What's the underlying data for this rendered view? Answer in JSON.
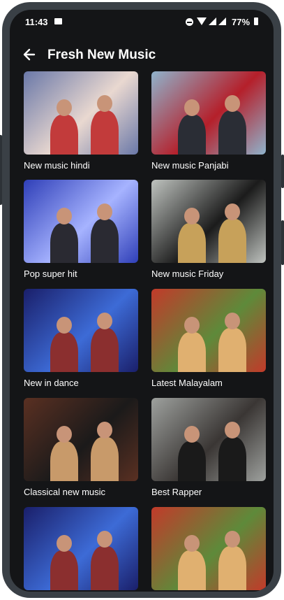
{
  "status_bar": {
    "time": "11:43",
    "battery": "77%"
  },
  "app_bar": {
    "back_icon": "arrow-left-icon",
    "title": "Fresh New Music"
  },
  "playlists": [
    {
      "label": "New music hindi",
      "colors": [
        "#6a78a8",
        "#e9d8d0",
        "#c23b3b"
      ]
    },
    {
      "label": "New music Panjabi",
      "colors": [
        "#8fb3cc",
        "#b51f2a",
        "#2a2d35"
      ]
    },
    {
      "label": "Pop super hit",
      "colors": [
        "#2f3fb8",
        "#a6b3ff",
        "#2a2a32"
      ]
    },
    {
      "label": "New music Friday",
      "colors": [
        "#bfc3bf",
        "#1b1b1b",
        "#c7a15a"
      ]
    },
    {
      "label": "New in dance",
      "colors": [
        "#1a1f6a",
        "#3d6bd6",
        "#8b2f2f"
      ]
    },
    {
      "label": "Latest Malayalam",
      "colors": [
        "#c23a2a",
        "#5e8a3a",
        "#e0b070"
      ]
    },
    {
      "label": "Classical new music",
      "colors": [
        "#5a3022",
        "#1b1a1a",
        "#c89a6a"
      ]
    },
    {
      "label": "Best Rapper",
      "colors": [
        "#9ea19e",
        "#3a3634",
        "#1a1a1a"
      ]
    },
    {
      "label": "",
      "colors": [
        "#1a1f6a",
        "#3d6bd6",
        "#8b2f2f"
      ]
    },
    {
      "label": "",
      "colors": [
        "#c23a2a",
        "#5e8a3a",
        "#e0b070"
      ]
    }
  ]
}
